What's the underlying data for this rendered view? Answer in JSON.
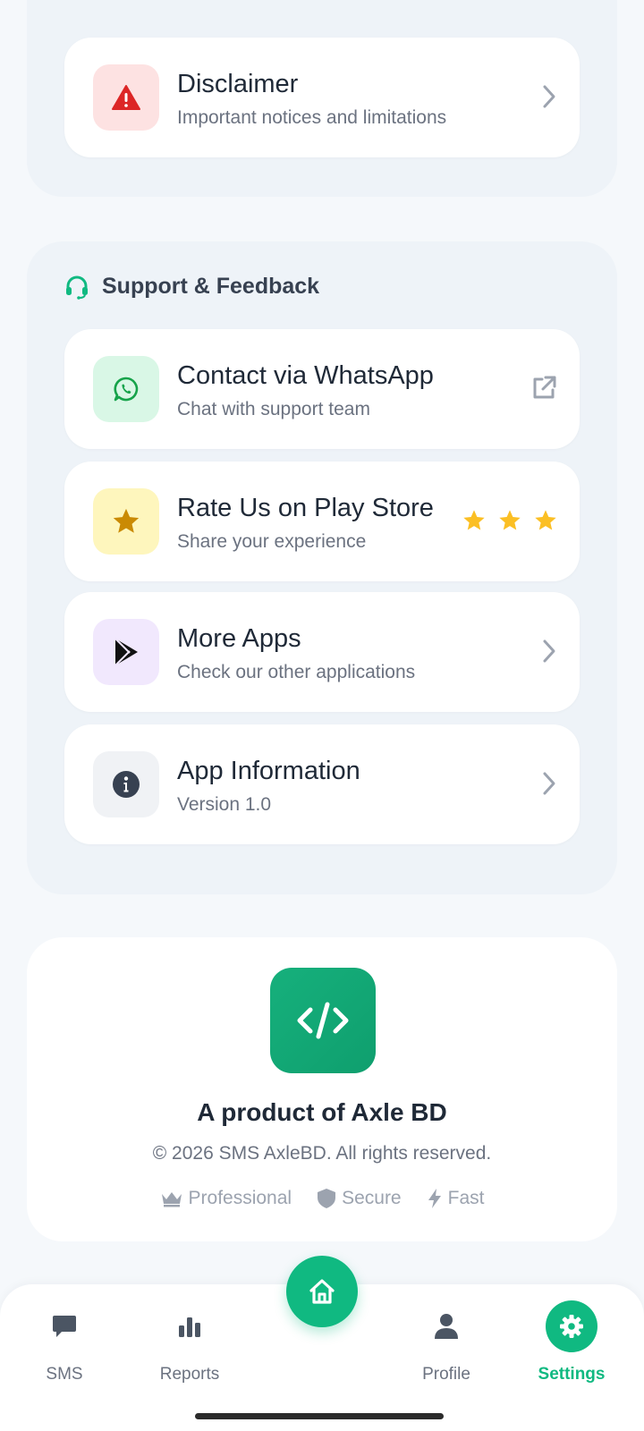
{
  "colors": {
    "accent": "#10b981",
    "danger": "#dc2626",
    "star": "#fbbf24"
  },
  "legal": {
    "items": [
      {
        "title": "Disclaimer",
        "subtitle": "Important notices and limitations",
        "icon": "warning-icon",
        "trailing": "chevron-right-icon"
      }
    ]
  },
  "support": {
    "header": "Support & Feedback",
    "header_icon": "headset-icon",
    "items": [
      {
        "title": "Contact via WhatsApp",
        "subtitle": "Chat with support team",
        "icon": "whatsapp-icon",
        "trailing": "external-link-icon"
      },
      {
        "title": "Rate Us on Play Store",
        "subtitle": "Share your experience",
        "icon": "star-icon",
        "trailing": "star-rating",
        "rating_stars": 3
      },
      {
        "title": "More Apps",
        "subtitle": "Check our other applications",
        "icon": "play-store-icon",
        "trailing": "chevron-right-icon"
      },
      {
        "title": "App Information",
        "subtitle": "Version 1.0",
        "icon": "info-icon",
        "trailing": "chevron-right-icon"
      }
    ]
  },
  "brand": {
    "logo_icon": "code-icon",
    "title": "A product of Axle BD",
    "copyright": "© 2026 SMS AxleBD. All rights reserved.",
    "badges": [
      {
        "label": "Professional",
        "icon": "crown-icon"
      },
      {
        "label": "Secure",
        "icon": "shield-icon"
      },
      {
        "label": "Fast",
        "icon": "bolt-icon"
      }
    ]
  },
  "nav": {
    "items": [
      {
        "label": "SMS",
        "icon": "message-icon"
      },
      {
        "label": "Reports",
        "icon": "bar-chart-icon"
      },
      {
        "label": "Home",
        "icon": "home-icon"
      },
      {
        "label": "Profile",
        "icon": "user-icon"
      },
      {
        "label": "Settings",
        "icon": "gear-icon",
        "active": true
      }
    ]
  }
}
